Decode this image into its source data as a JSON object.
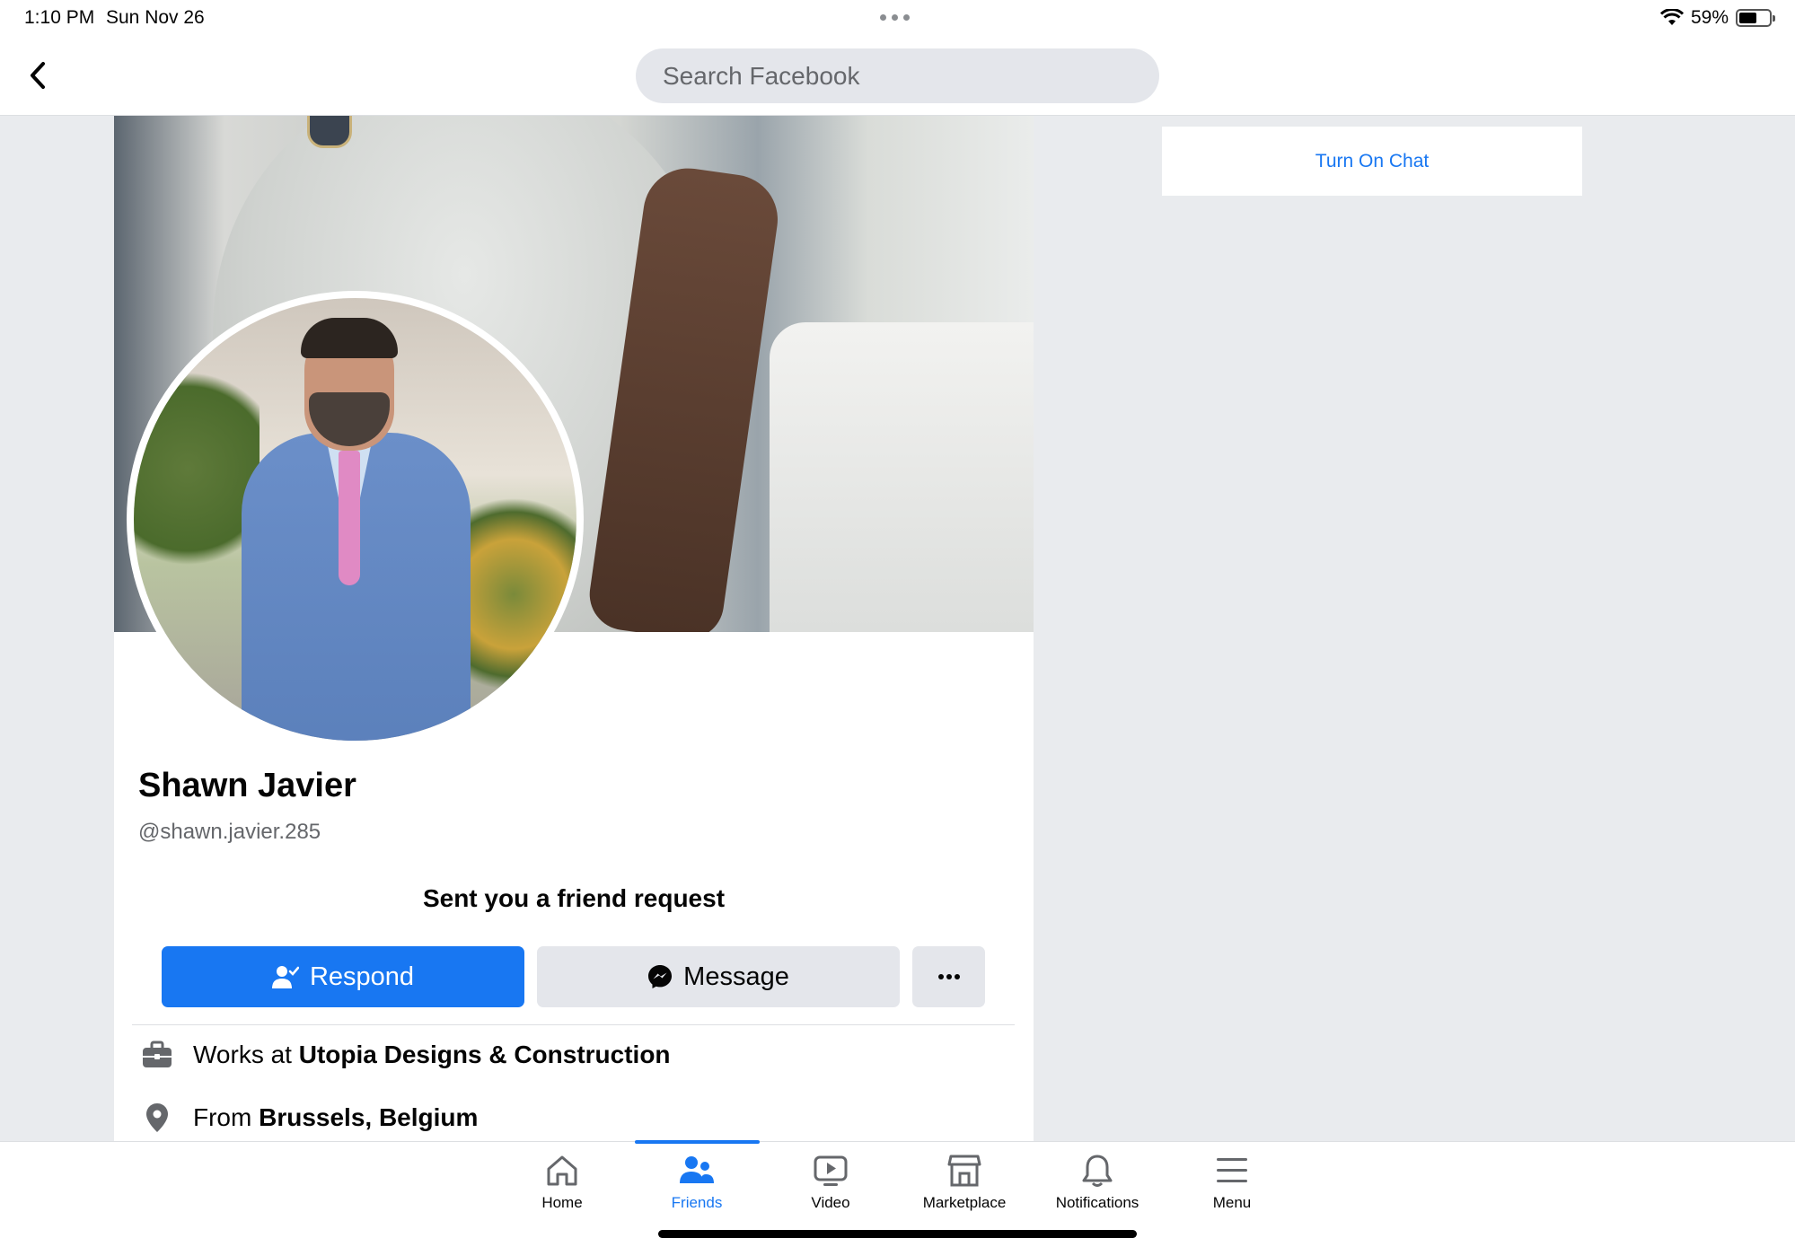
{
  "status_bar": {
    "time": "1:10 PM",
    "date": "Sun Nov 26",
    "battery_percent": "59%",
    "battery_level": 0.59
  },
  "search": {
    "placeholder": "Search Facebook"
  },
  "profile": {
    "name": "Shawn Javier",
    "handle": "@shawn.javier.285",
    "request_text": "Sent you a friend request",
    "respond_label": "Respond",
    "message_label": "Message",
    "more_label": "···",
    "work_prefix": "Works at",
    "work_place": "Utopia Designs & Construction",
    "from_prefix": "From",
    "from_place": "Brussels, Belgium"
  },
  "chat": {
    "turn_on_label": "Turn On Chat"
  },
  "tabs": [
    {
      "label": "Home",
      "icon": "home-icon",
      "active": false
    },
    {
      "label": "Friends",
      "icon": "friends-icon",
      "active": true
    },
    {
      "label": "Video",
      "icon": "video-icon",
      "active": false
    },
    {
      "label": "Marketplace",
      "icon": "marketplace-icon",
      "active": false
    },
    {
      "label": "Notifications",
      "icon": "bell-icon",
      "active": false
    },
    {
      "label": "Menu",
      "icon": "menu-icon",
      "active": false
    }
  ],
  "colors": {
    "accent": "#1877f2",
    "background": "#e9ebee",
    "button_gray": "#e4e6eb"
  }
}
